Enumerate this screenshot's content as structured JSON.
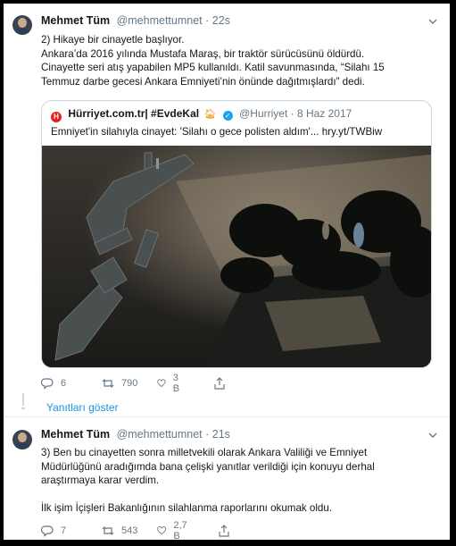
{
  "tweet1": {
    "display_name": "Mehmet Tüm",
    "handle": "@mehmettumnet",
    "time": "22s",
    "lines": [
      "2) Hikaye bir cinayetle başlıyor.",
      "Ankara’da 2016 yılında Mustafa Maraş, bir traktör sürücüsünü öldürdü.",
      "Cinayette seri atış yapabilen MP5 kullanıldı. Katil savunmasında, “Silahı 15",
      "Temmuz darbe gecesi Ankara Emniyeti’nin önünde dağıtmışlardı” dedi."
    ],
    "quote": {
      "logo_letter": "H",
      "name": "Hürriyet.com.tr| #EvdeKal",
      "handle": "@Hurriyet",
      "date": "· 8 Haz 2017",
      "text": "Emniyet'in silahıyla cinayet: 'Silahı o gece polisten aldım'... hry.yt/TWBiw"
    },
    "replies": "6",
    "retweets": "790",
    "likes": "3 B"
  },
  "show_replies": "Yanıtları göster",
  "tweet2": {
    "display_name": "Mehmet Tüm",
    "handle": "@mehmettumnet",
    "time": "21s",
    "lines": [
      "3) Ben bu cinayetten sonra milletvekili olarak Ankara Valiliği ve Emniyet",
      "Müdürlüğünü aradığımda bana çelişki yanıtlar verildiği için konuyu derhal",
      "araştırmaya karar verdim."
    ],
    "line_extra": "İlk işim İçişleri Bakanlığının silahlanma raporlarını okumak oldu.",
    "replies": "7",
    "retweets": "543",
    "likes": "2,7 B"
  },
  "colors": {
    "link": "#1b95e0",
    "verified": "#1da1f2",
    "muted": "#657786",
    "text": "#14171a",
    "brand": "#e2221f"
  },
  "icons": [
    "reply-icon",
    "retweet-icon",
    "like-icon",
    "share-icon",
    "chevron-down-icon",
    "verified-icon",
    "house-icon"
  ]
}
